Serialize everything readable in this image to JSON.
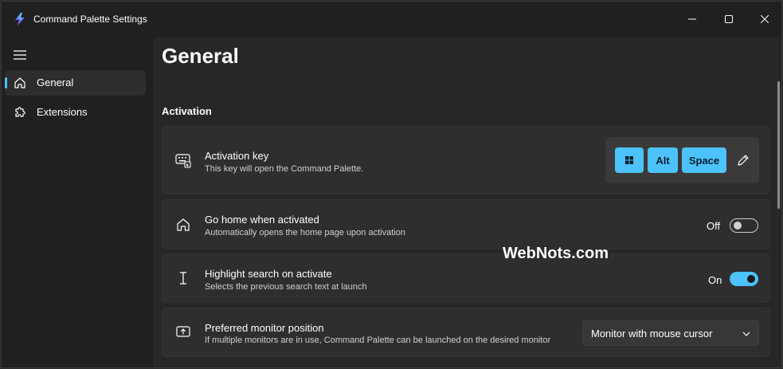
{
  "window": {
    "title": "Command Palette Settings"
  },
  "sidebar": {
    "items": [
      {
        "label": "General",
        "icon": "home-icon",
        "selected": true
      },
      {
        "label": "Extensions",
        "icon": "puzzle-icon",
        "selected": false
      }
    ]
  },
  "page": {
    "title": "General",
    "section": "Activation"
  },
  "settings": {
    "activation_key": {
      "title": "Activation key",
      "description": "This key will open the Command Palette.",
      "keys": [
        "Alt",
        "Space"
      ]
    },
    "go_home": {
      "title": "Go home when activated",
      "description": "Automatically opens the home page upon activation",
      "state_label": "Off"
    },
    "highlight_search": {
      "title": "Highlight search on activate",
      "description": "Selects the previous search text at launch",
      "state_label": "On"
    },
    "monitor_position": {
      "title": "Preferred monitor position",
      "description": "If multiple monitors are in use, Command Palette can be launched on the desired monitor",
      "selected": "Monitor with mouse cursor"
    }
  },
  "watermark": "WebNots.com",
  "colors": {
    "accent": "#4cc2ff",
    "background": "#202020",
    "card": "#2e2e2e"
  }
}
